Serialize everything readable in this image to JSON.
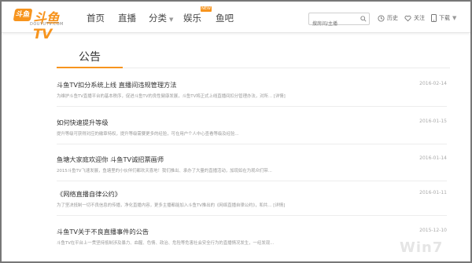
{
  "header": {
    "logo_text": "斗鱼TV",
    "logo_badge": "斗鱼",
    "logo_sub": "DOUYUTV.COM",
    "nav": [
      {
        "label": "首页"
      },
      {
        "label": "直播"
      },
      {
        "label": "分类"
      },
      {
        "label": "娱乐",
        "badge": "NEW"
      },
      {
        "label": "鱼吧"
      }
    ],
    "search_placeholder": "搜房间/主播",
    "history_label": "历史",
    "follow_label": "关注",
    "download_label": "下载"
  },
  "page": {
    "title": "公告"
  },
  "notices": [
    {
      "title": "斗鱼TV扣分系统上线 直播间违规管理方法",
      "date": "2016-02-14",
      "summary": "为维护斗鱼TV直播平台的基本秩序，促进斗鱼TV的良性健康发展，斗鱼TV将正式上线直播间扣分管理办法，对所... [详情]"
    },
    {
      "title": "如何快速提升等级",
      "date": "2016-01-15",
      "summary": "提升等级可获得对应的徽章特权，提升等级需要更多的经验，可在用户个人中心查看等级及经验..."
    },
    {
      "title": "鱼塘大家庭欢迎你 斗鱼TV诚招票画师",
      "date": "2016-01-14",
      "summary": "2015斗鱼TV飞速发展，鱼塘里的小伙伴们都欢天喜地！我们推出、承办了大量的直播活动，加现如在为观众们带..."
    },
    {
      "title": "《网络直播自律公约》",
      "date": "2016-01-11",
      "summary": "为了坚决抵制一切不良信息的传播，净化直播内容，更多主播都能加入斗鱼TV推出的《网络直播自律公约》，和共... [详情]"
    },
    {
      "title": "斗鱼TV关于不良直播事件的公告",
      "date": "2015-12-10",
      "summary": "斗鱼TV在平台上一贯坚持抵制涉及暴力、血腥、色情、政治、危险等危害社会安全行为的直播情况发生，一经发现..."
    }
  ],
  "watermark": "Win7",
  "colors": {
    "accent": "#f7941d",
    "text": "#333333",
    "muted": "#999999"
  }
}
